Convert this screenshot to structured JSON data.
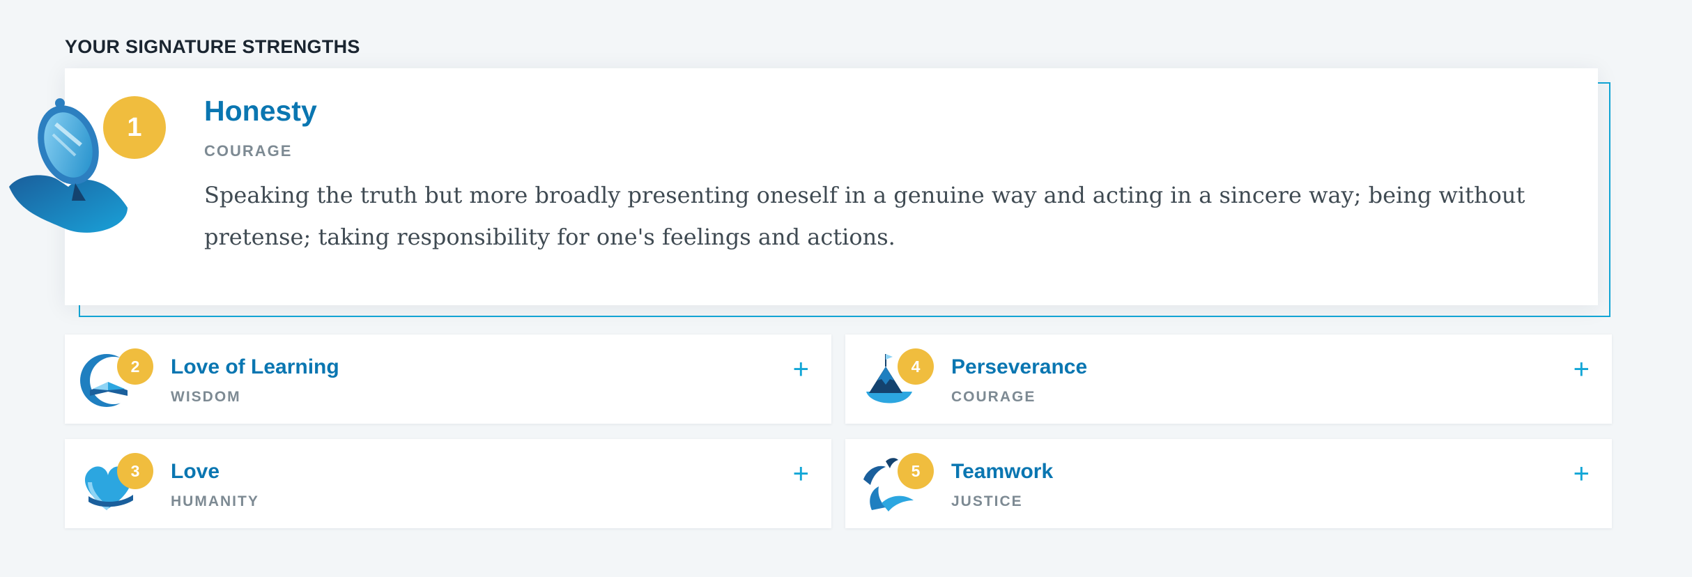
{
  "section": {
    "title": "YOUR SIGNATURE STRENGTHS"
  },
  "featured": {
    "rank": "1",
    "name": "Honesty",
    "virtue": "COURAGE",
    "description": "Speaking the truth but more broadly presenting oneself in a genuine way and acting in a sincere way; being without pretense; taking responsibility for one's feelings and actions.",
    "icon": "hand-mirror-icon"
  },
  "strengths": [
    {
      "rank": "2",
      "name": "Love of Learning",
      "virtue": "WISDOM",
      "icon": "open-book-icon",
      "expand": "+"
    },
    {
      "rank": "3",
      "name": "Love",
      "virtue": "HUMANITY",
      "icon": "heart-icon",
      "expand": "+"
    },
    {
      "rank": "4",
      "name": "Perseverance",
      "virtue": "COURAGE",
      "icon": "mountain-flag-icon",
      "expand": "+"
    },
    {
      "rank": "5",
      "name": "Teamwork",
      "virtue": "JUSTICE",
      "icon": "birds-icon",
      "expand": "+"
    }
  ],
  "colors": {
    "accent": "#0a76b1",
    "badge": "#f0bd3e",
    "frame": "#12a6d6",
    "muted": "#7d8a93"
  }
}
